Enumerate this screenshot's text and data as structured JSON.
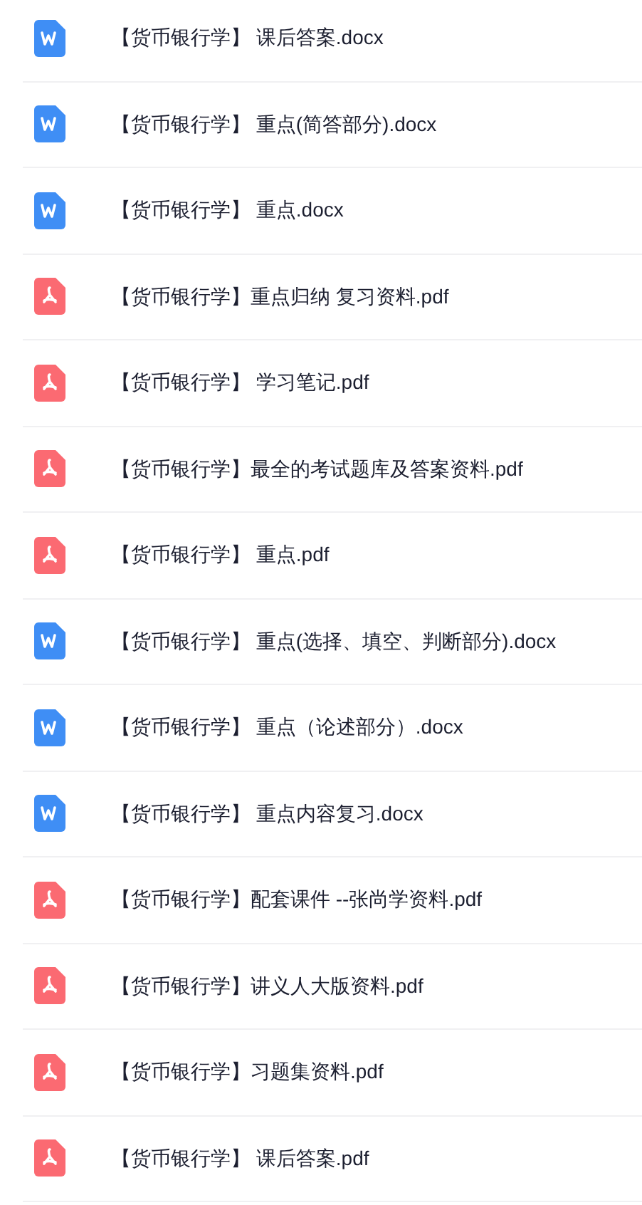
{
  "files": [
    {
      "kind": "word",
      "name": "【货币银行学】 课后答案.docx"
    },
    {
      "kind": "word",
      "name": "【货币银行学】 重点(简答部分).docx"
    },
    {
      "kind": "word",
      "name": "【货币银行学】 重点.docx"
    },
    {
      "kind": "pdf",
      "name": "【货币银行学】重点归纳 复习资料.pdf"
    },
    {
      "kind": "pdf",
      "name": "【货币银行学】 学习笔记.pdf"
    },
    {
      "kind": "pdf",
      "name": "【货币银行学】最全的考试题库及答案资料.pdf"
    },
    {
      "kind": "pdf",
      "name": "【货币银行学】 重点.pdf"
    },
    {
      "kind": "word",
      "name": "【货币银行学】 重点(选择、填空、判断部分).docx"
    },
    {
      "kind": "word",
      "name": "【货币银行学】 重点（论述部分）.docx"
    },
    {
      "kind": "word",
      "name": "【货币银行学】 重点内容复习.docx"
    },
    {
      "kind": "pdf",
      "name": "【货币银行学】配套课件 --张尚学资料.pdf"
    },
    {
      "kind": "pdf",
      "name": "【货币银行学】讲义人大版资料.pdf"
    },
    {
      "kind": "pdf",
      "name": "【货币银行学】习题集资料.pdf"
    },
    {
      "kind": "pdf",
      "name": "【货币银行学】 课后答案.pdf"
    }
  ]
}
